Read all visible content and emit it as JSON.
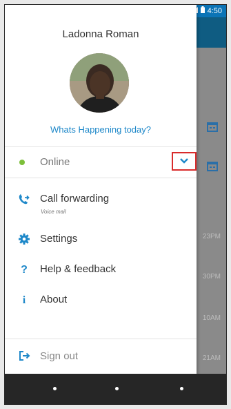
{
  "status_bar": {
    "time": "4:50",
    "wifi_icon": "wifi-icon",
    "signal_icon": "signal-icon",
    "battery_icon": "battery-icon"
  },
  "profile": {
    "name": "Ladonna Roman",
    "mood": "Whats Happening today?"
  },
  "presence": {
    "status_label": "Online",
    "status_color": "#7cbf3a",
    "dropdown_icon": "chevron-down-icon"
  },
  "menu": {
    "items": [
      {
        "label": "Call forwarding",
        "sublabel": "Voice mail",
        "icon": "call-forward-icon"
      },
      {
        "label": "Settings",
        "icon": "gear-icon"
      },
      {
        "label": "Help & feedback",
        "icon": "question-icon"
      },
      {
        "label": "About",
        "icon": "info-icon"
      }
    ],
    "signout_label": "Sign out",
    "signout_icon": "sign-out-icon"
  },
  "background_times": [
    "23PM",
    "30PM",
    "10AM",
    "21AM"
  ],
  "colors": {
    "accent": "#1e88c9",
    "highlight_border": "#d92b2b",
    "statusbar": "#0b74b6"
  }
}
